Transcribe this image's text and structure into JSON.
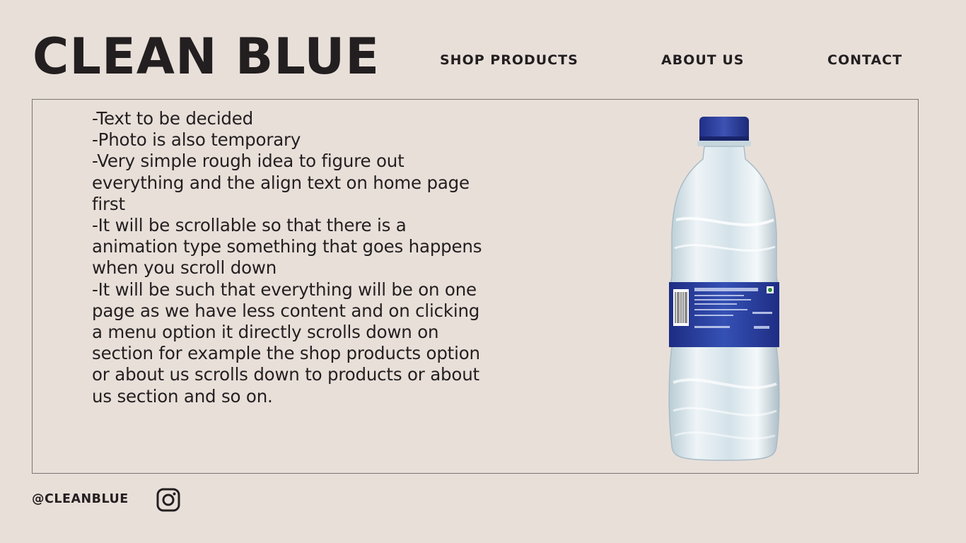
{
  "header": {
    "brand": "CLEAN BLUE",
    "nav": [
      {
        "label": "SHOP PRODUCTS"
      },
      {
        "label": "ABOUT US"
      },
      {
        "label": "CONTACT"
      }
    ]
  },
  "main": {
    "notes": [
      "-Text to be decided",
      "-Photo is also temporary",
      "-Very simple rough idea to figure out everything and the align text on home page first",
      "-It will be scrollable so that there is a animation type something that goes happens when you scroll down",
      "-It will be such that everything will be on one page as we have less content and on clicking a menu option it directly scrolls down on section for example the shop products option or about us scrolls down to products or about us section and so on."
    ],
    "image": {
      "icon": "water-bottle-photo"
    }
  },
  "footer": {
    "handle": "@CLEANBLUE",
    "social_icon": "instagram-icon"
  },
  "colors": {
    "background": "#e8dfd9",
    "text": "#231f20",
    "border": "#7a7470",
    "bottle_label": "#2a3f9a"
  }
}
